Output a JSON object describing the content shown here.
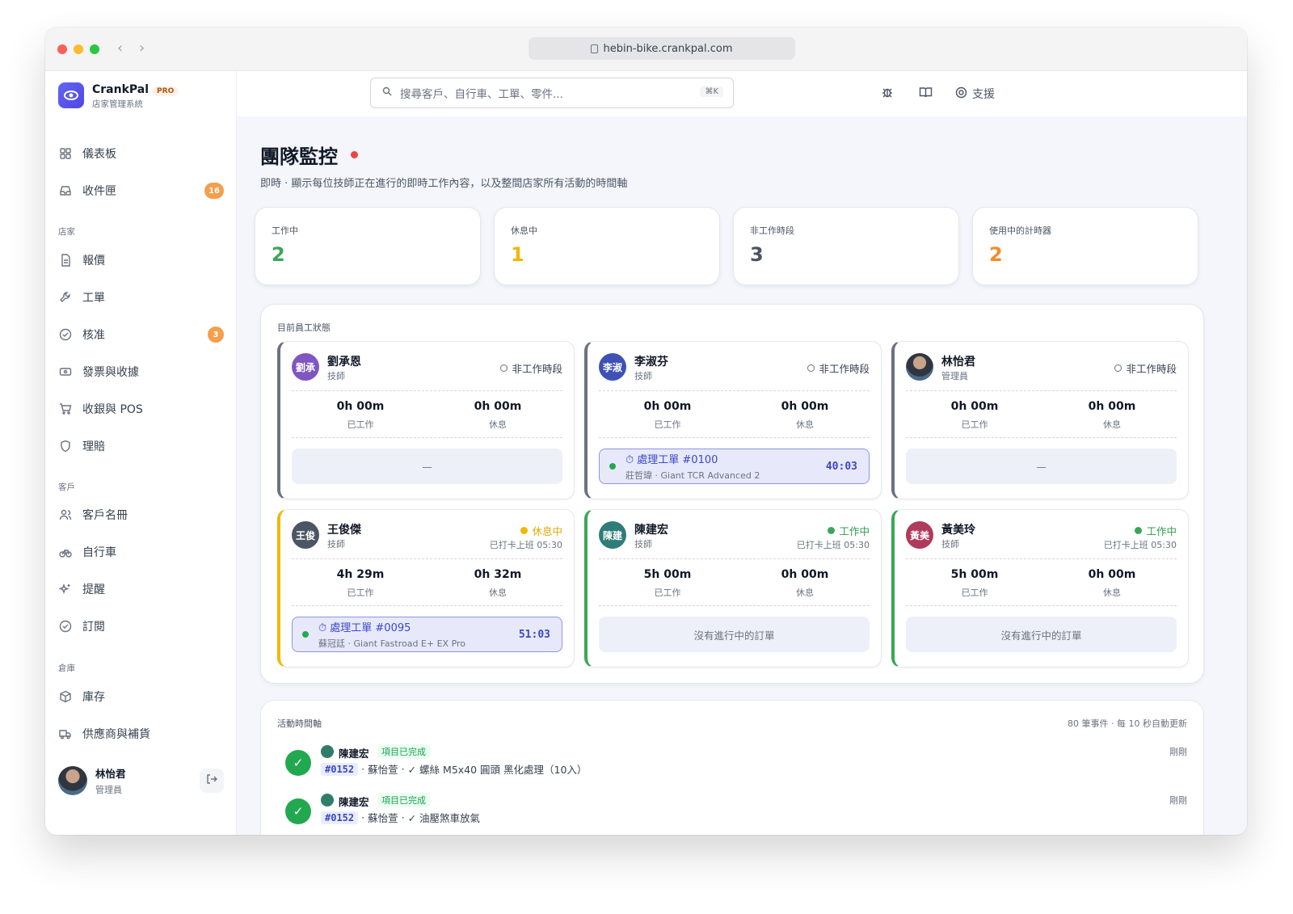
{
  "browser": {
    "url": "hebin-bike.crankpal.com"
  },
  "brand": {
    "name": "CrankPal",
    "tier": "PRO",
    "subtitle": "店家管理系統"
  },
  "sidebar": {
    "top_items": [
      {
        "label": "儀表板",
        "icon": "dashboard-icon"
      },
      {
        "label": "收件匣",
        "icon": "inbox-icon",
        "badge": "16"
      }
    ],
    "sections": [
      {
        "title": "店家",
        "items": [
          {
            "label": "報價",
            "icon": "quote-icon"
          },
          {
            "label": "工單",
            "icon": "wrench-icon"
          },
          {
            "label": "核准",
            "icon": "check-circle-icon",
            "badge": "3"
          },
          {
            "label": "發票與收據",
            "icon": "receipt-icon"
          },
          {
            "label": "收銀與 POS",
            "icon": "cart-icon"
          },
          {
            "label": "理賠",
            "icon": "shield-icon"
          }
        ]
      },
      {
        "title": "客戶",
        "items": [
          {
            "label": "客戶名冊",
            "icon": "users-icon"
          },
          {
            "label": "自行車",
            "icon": "bike-icon"
          },
          {
            "label": "提醒",
            "icon": "sparkle-icon"
          },
          {
            "label": "訂閱",
            "icon": "subscription-icon"
          }
        ]
      },
      {
        "title": "倉庫",
        "items": [
          {
            "label": "庫存",
            "icon": "box-icon"
          },
          {
            "label": "供應商與補貨",
            "icon": "truck-icon"
          }
        ]
      }
    ],
    "user": {
      "name": "林怡君",
      "role": "管理員"
    }
  },
  "topbar": {
    "search_placeholder": "搜尋客戶、自行車、工單、零件...",
    "shortcut": "⌘K",
    "support_label": "支援"
  },
  "page": {
    "title": "團隊監控",
    "subtitle": "即時 · 顯示每位技師正在進行的即時工作內容，以及整間店家所有活動的時間軸"
  },
  "stats": [
    {
      "label": "工作中",
      "value": "2",
      "color": "#3aa757"
    },
    {
      "label": "休息中",
      "value": "1",
      "color": "#f2b705"
    },
    {
      "label": "非工作時段",
      "value": "3",
      "color": "#4b5563"
    },
    {
      "label": "使用中的計時器",
      "value": "2",
      "color": "#f28c28"
    }
  ],
  "staff_panel": {
    "title": "目前員工狀態",
    "worked_label": "已工作",
    "break_label": "休息",
    "employees": [
      {
        "initials": "劉承",
        "name": "劉承恩",
        "role": "技師",
        "status": "非工作時段",
        "clock": "",
        "worked": "0h 00m",
        "break": "0h 00m",
        "slot": "—",
        "avatar_color": "#7e57c2",
        "accent": "#6b7280"
      },
      {
        "initials": "李淑",
        "name": "李淑芬",
        "role": "技師",
        "status": "非工作時段",
        "clock": "",
        "worked": "0h 00m",
        "break": "0h 00m",
        "job": {
          "title": "處理工單 #0100",
          "sub": "莊哲瑋 · Giant TCR Advanced 2",
          "timer": "40:03"
        },
        "avatar_color": "#3f51b5",
        "accent": "#6b7280"
      },
      {
        "initials": "",
        "name": "林怡君",
        "role": "管理員",
        "status": "非工作時段",
        "clock": "",
        "worked": "0h 00m",
        "break": "0h 00m",
        "slot": "—",
        "avatar_color": "#4a6b8a",
        "accent": "#6b7280"
      },
      {
        "initials": "王俊",
        "name": "王俊傑",
        "role": "技師",
        "status": "休息中",
        "clock": "已打卡上班 05:30",
        "worked": "4h 29m",
        "break": "0h 32m",
        "job": {
          "title": "處理工單 #0095",
          "sub": "蘇冠廷 · Giant Fastroad E+ EX Pro",
          "timer": "51:03"
        },
        "avatar_color": "#4b5563",
        "accent": "#f2b705"
      },
      {
        "initials": "陳建",
        "name": "陳建宏",
        "role": "技師",
        "status": "工作中",
        "clock": "已打卡上班 05:30",
        "worked": "5h 00m",
        "break": "0h 00m",
        "slot": "沒有進行中的訂單",
        "avatar_color": "#2f7d7a",
        "accent": "#3aa757"
      },
      {
        "initials": "黃美",
        "name": "黃美玲",
        "role": "技師",
        "status": "工作中",
        "clock": "已打卡上班 05:30",
        "worked": "5h 00m",
        "break": "0h 00m",
        "slot": "沒有進行中的訂單",
        "avatar_color": "#b0395e",
        "accent": "#3aa757"
      }
    ]
  },
  "timeline": {
    "title": "活動時間軸",
    "meta": "80 筆事件 · 每 10 秒自動更新",
    "events": [
      {
        "name": "陳建宏",
        "tag": "項目已完成",
        "order": "#0152",
        "customer": "蘇怡萱",
        "detail": "✓ 螺絲 M5x40 圓頭 黑化處理（10入）",
        "time": "剛剛"
      },
      {
        "name": "陳建宏",
        "tag": "項目已完成",
        "order": "#0152",
        "customer": "蘇怡萱",
        "detail": "✓ 油壓煞車放氣",
        "time": "剛剛"
      }
    ]
  }
}
